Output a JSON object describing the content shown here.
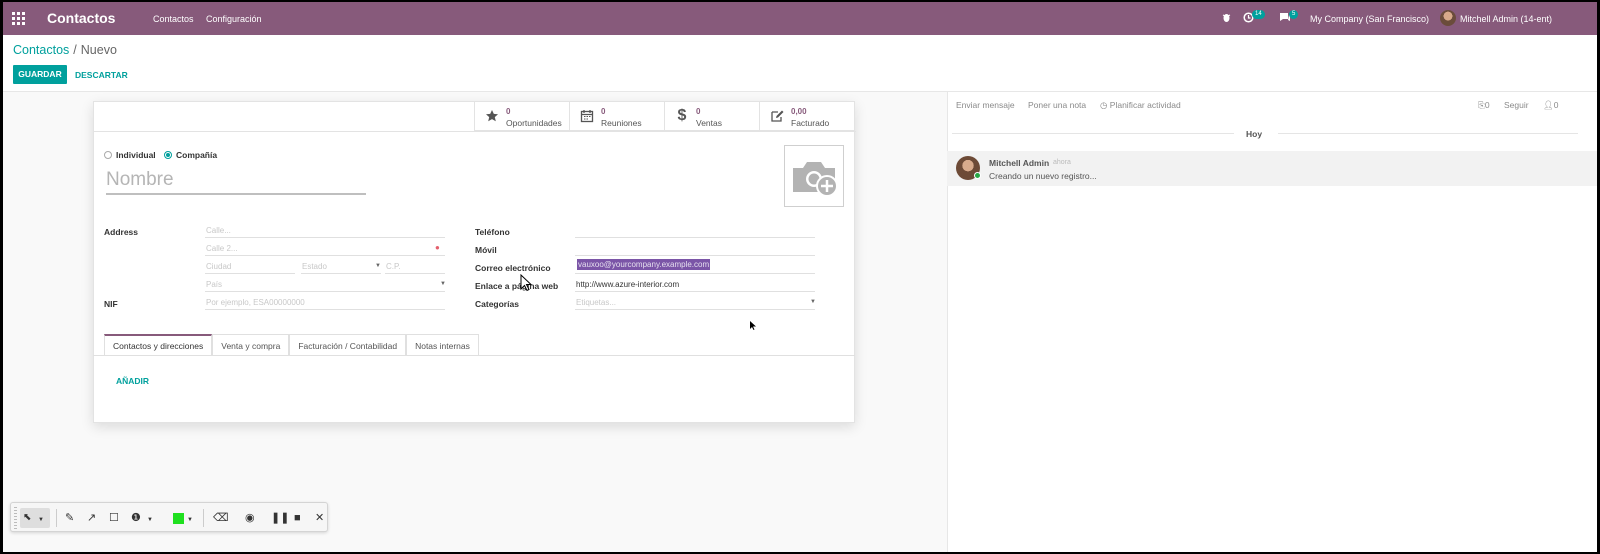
{
  "navbar": {
    "brand": "Contactos",
    "menu": [
      "Contactos",
      "Configuración"
    ],
    "activity_count": "14",
    "message_count": "5",
    "company": "My Company (San Francisco)",
    "user": "Mitchell Admin (14-ent)"
  },
  "breadcrumb": {
    "parent": "Contactos",
    "separator": "/",
    "current": "Nuevo"
  },
  "actions": {
    "save": "GUARDAR",
    "discard": "DESCARTAR"
  },
  "stat_buttons": [
    {
      "icon": "star-icon",
      "value": "0",
      "label": "Oportunidades"
    },
    {
      "icon": "calendar-icon",
      "value": "0",
      "label": "Reuniones"
    },
    {
      "icon": "dollar-icon",
      "value": "0",
      "label": "Ventas"
    },
    {
      "icon": "edit-icon",
      "value": "0,00",
      "label": "Facturado"
    }
  ],
  "company_type": {
    "individual": "Individual",
    "company": "Compañía",
    "selected": "company"
  },
  "name_placeholder": "Nombre",
  "address": {
    "label": "Address",
    "street_placeholder": "Calle...",
    "street2_placeholder": "Calle 2...",
    "city_placeholder": "Ciudad",
    "state_placeholder": "Estado",
    "zip_placeholder": "C.P.",
    "country_placeholder": "País"
  },
  "nif": {
    "label": "NIF",
    "placeholder": "Por ejemplo, ESA00000000"
  },
  "right_fields": {
    "phone_label": "Teléfono",
    "mobile_label": "Móvil",
    "email_label": "Correo electrónico",
    "email_value": "vauxoo@yourcompany.example.com",
    "website_label": "Enlace a página web",
    "website_value": "http://www.azure-interior.com",
    "categories_label": "Categorías",
    "categories_placeholder": "Etiquetas..."
  },
  "tabs": [
    "Contactos y direcciones",
    "Venta y compra",
    "Facturación / Contabilidad",
    "Notas internas"
  ],
  "add_label": "AÑADIR",
  "chatter": {
    "send_message": "Enviar mensaje",
    "log_note": "Poner una nota",
    "schedule": "Planificar actividad",
    "attachments": "0",
    "follow": "Seguir",
    "followers": "0",
    "today": "Hoy",
    "message": {
      "author": "Mitchell Admin",
      "time": "ahora",
      "body": "Creando un nuevo registro..."
    }
  },
  "colors": {
    "primary": "#875a7b",
    "accent": "#00a09d",
    "selection": "#7b55a7",
    "recorder_color": "#1fe01f"
  }
}
